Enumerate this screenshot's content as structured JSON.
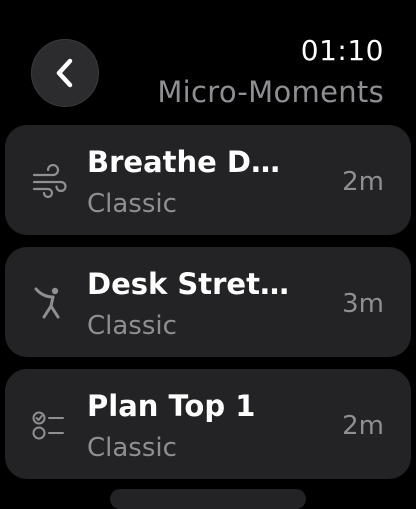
{
  "header": {
    "time": "01:10",
    "title": "Micro-Moments",
    "back_icon": "chevron-left-icon"
  },
  "sessions": [
    {
      "name": "Breathe De…",
      "style": "Classic",
      "duration": "2m",
      "icon": "wind-icon"
    },
    {
      "name": "Desk Stretch",
      "style": "Classic",
      "duration": "3m",
      "icon": "stretching-figure-icon"
    },
    {
      "name": "Plan Top 1",
      "style": "Classic",
      "duration": "2m",
      "icon": "checklist-icon"
    }
  ],
  "colors": {
    "background": "#000000",
    "row_background": "#232325",
    "primary_text": "#ffffff",
    "secondary_text": "#8e8e93",
    "icon_gray": "#8e8e93"
  }
}
